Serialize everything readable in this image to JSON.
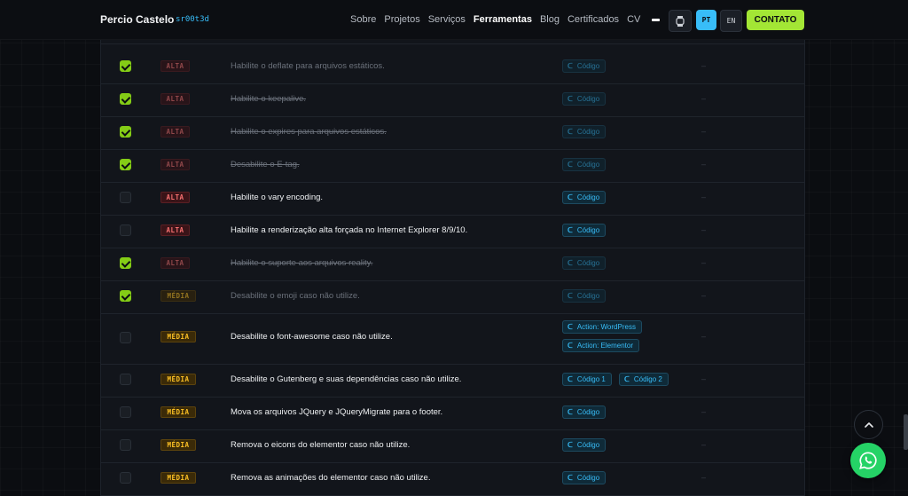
{
  "header": {
    "brand": "Percio Castelo",
    "handle": "sr00t3d",
    "nav": [
      "Sobre",
      "Projetos",
      "Serviços",
      "Ferramentas",
      "Blog",
      "Certificados",
      "CV"
    ],
    "active_nav": "Ferramentas",
    "lang_pt": "PT",
    "lang_en": "EN",
    "contact": "CONTATO",
    "accent": "#a3e635",
    "lang_active_color": "#38bdf8"
  },
  "rows": [
    {
      "checked": true,
      "priority": "ALTA",
      "task": "Habilite o deflate para arquivos estáticos.",
      "codes": [
        "Código"
      ],
      "extra": "–"
    },
    {
      "checked": true,
      "priority": "ALTA",
      "task": "Habilite o keepalive.",
      "codes": [
        "Código"
      ],
      "extra": "–"
    },
    {
      "checked": true,
      "priority": "ALTA",
      "task": "Habilite o expires para arquivos estáticos.",
      "codes": [
        "Código"
      ],
      "extra": "–"
    },
    {
      "checked": true,
      "priority": "ALTA",
      "task": "Desabilite o E-tag.",
      "codes": [
        "Código"
      ],
      "extra": "–"
    },
    {
      "checked": false,
      "priority": "ALTA",
      "task": "Habilite o vary encoding.",
      "codes": [
        "Código"
      ],
      "extra": "–"
    },
    {
      "checked": false,
      "priority": "ALTA",
      "task": "Habilite a renderização alta forçada no Internet Explorer 8/9/10.",
      "codes": [
        "Código"
      ],
      "extra": "–"
    },
    {
      "checked": true,
      "priority": "ALTA",
      "task": "Habilite o suporte aos arquivos reality.",
      "codes": [
        "Código"
      ],
      "extra": "–"
    },
    {
      "checked": true,
      "priority": "MÉDIA",
      "task": "Desabilite o emoji caso não utilize.",
      "codes": [
        "Código"
      ],
      "extra": "–"
    },
    {
      "checked": false,
      "priority": "MÉDIA",
      "task": "Desabilite o font-awesome caso não utilize.",
      "codes": [
        "Action: WordPress",
        "Action: Elementor"
      ],
      "extra": "–"
    },
    {
      "checked": false,
      "priority": "MÉDIA",
      "task": "Desabilite o Gutenberg e suas dependências caso não utilize.",
      "codes": [
        "Código 1",
        "Código 2"
      ],
      "extra": "–"
    },
    {
      "checked": false,
      "priority": "MÉDIA",
      "task": "Mova os arquivos JQuery e JQueryMigrate para o footer.",
      "codes": [
        "Código"
      ],
      "extra": "–"
    },
    {
      "checked": false,
      "priority": "MÉDIA",
      "task": "Remova o eicons do elementor caso não utilize.",
      "codes": [
        "Código"
      ],
      "extra": "–"
    },
    {
      "checked": false,
      "priority": "MÉDIA",
      "task": "Remova as animações do elementor caso não utilize.",
      "codes": [
        "Código"
      ],
      "extra": "–"
    }
  ],
  "icons": {
    "code_icon": "link-icon",
    "scroll_top": "chevron-up-icon",
    "whatsapp": "whatsapp-icon",
    "watch": "watch-icon"
  }
}
